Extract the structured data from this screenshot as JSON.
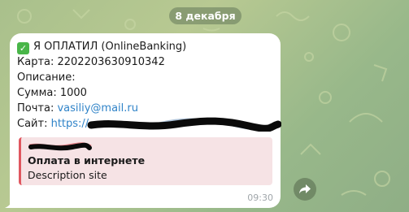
{
  "date_label": "8 декабря",
  "message": {
    "title": "Я ОПЛАТИЛ (OnlineBanking)",
    "card_line": "Карта: 2202203630910342",
    "description_line": "Описание:",
    "amount_line": "Сумма: 1000",
    "email_label": "Почта: ",
    "email_value": "vasiliy@mail.ru",
    "site_label": "Сайт: ",
    "site_value": "https://",
    "time": "09:30"
  },
  "preview": {
    "title": "Оплата в интернете",
    "description": "Description site"
  },
  "colors": {
    "accent_link": "#2f83c8",
    "preview_bar": "#e0575f",
    "check": "#49b649"
  },
  "icons": {
    "check": "check-mark-icon",
    "share": "share-arrow-icon"
  }
}
